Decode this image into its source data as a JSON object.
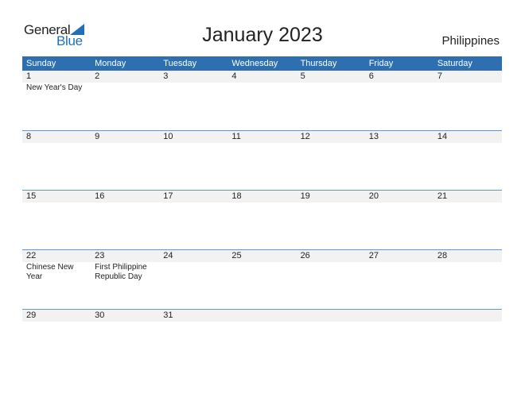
{
  "logo": {
    "text_general": "General",
    "text_blue": "Blue"
  },
  "title": "January 2023",
  "country": "Philippines",
  "colors": {
    "header_bg": "#2e6fb2",
    "accent": "#1f6fbd",
    "date_strip_bg": "#f2f2f2",
    "row_border": "#5f98cf"
  },
  "weekdays": [
    "Sunday",
    "Monday",
    "Tuesday",
    "Wednesday",
    "Thursday",
    "Friday",
    "Saturday"
  ],
  "weeks": [
    {
      "days": [
        "1",
        "2",
        "3",
        "4",
        "5",
        "6",
        "7"
      ],
      "events": [
        "New Year's Day",
        "",
        "",
        "",
        "",
        "",
        ""
      ]
    },
    {
      "days": [
        "8",
        "9",
        "10",
        "11",
        "12",
        "13",
        "14"
      ],
      "events": [
        "",
        "",
        "",
        "",
        "",
        "",
        ""
      ]
    },
    {
      "days": [
        "15",
        "16",
        "17",
        "18",
        "19",
        "20",
        "21"
      ],
      "events": [
        "",
        "",
        "",
        "",
        "",
        "",
        ""
      ]
    },
    {
      "days": [
        "22",
        "23",
        "24",
        "25",
        "26",
        "27",
        "28"
      ],
      "events": [
        "Chinese New Year",
        "First Philippine Republic Day",
        "",
        "",
        "",
        "",
        ""
      ]
    },
    {
      "days": [
        "29",
        "30",
        "31",
        "",
        "",
        "",
        ""
      ],
      "events": [
        "",
        "",
        "",
        "",
        "",
        "",
        ""
      ]
    }
  ]
}
